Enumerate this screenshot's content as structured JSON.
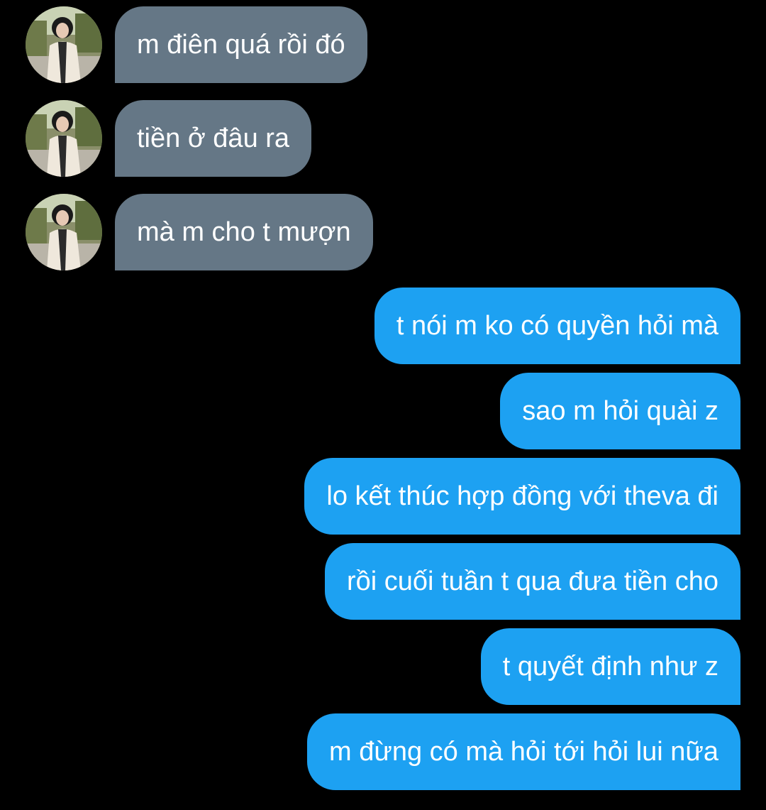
{
  "conversation": {
    "colors": {
      "background": "#000000",
      "incoming_bubble": "#657786",
      "outgoing_bubble": "#1DA1F2",
      "text": "#FFFFFF"
    },
    "incoming_avatar": "profile-photo-avatar",
    "messages": [
      {
        "direction": "incoming",
        "text": "m điên quá rồi đó"
      },
      {
        "direction": "incoming",
        "text": "tiền ở đâu ra"
      },
      {
        "direction": "incoming",
        "text": "mà m cho t mượn"
      },
      {
        "direction": "outgoing",
        "text": "t nói m ko có quyền hỏi mà"
      },
      {
        "direction": "outgoing",
        "text": "sao m hỏi quài z"
      },
      {
        "direction": "outgoing",
        "text": "lo kết thúc hợp đồng với theva đi"
      },
      {
        "direction": "outgoing",
        "text": "rồi cuối tuần t qua đưa tiền cho"
      },
      {
        "direction": "outgoing",
        "text": "t quyết định như z"
      },
      {
        "direction": "outgoing",
        "text": "m đừng có mà hỏi tới hỏi lui nữa"
      }
    ]
  }
}
